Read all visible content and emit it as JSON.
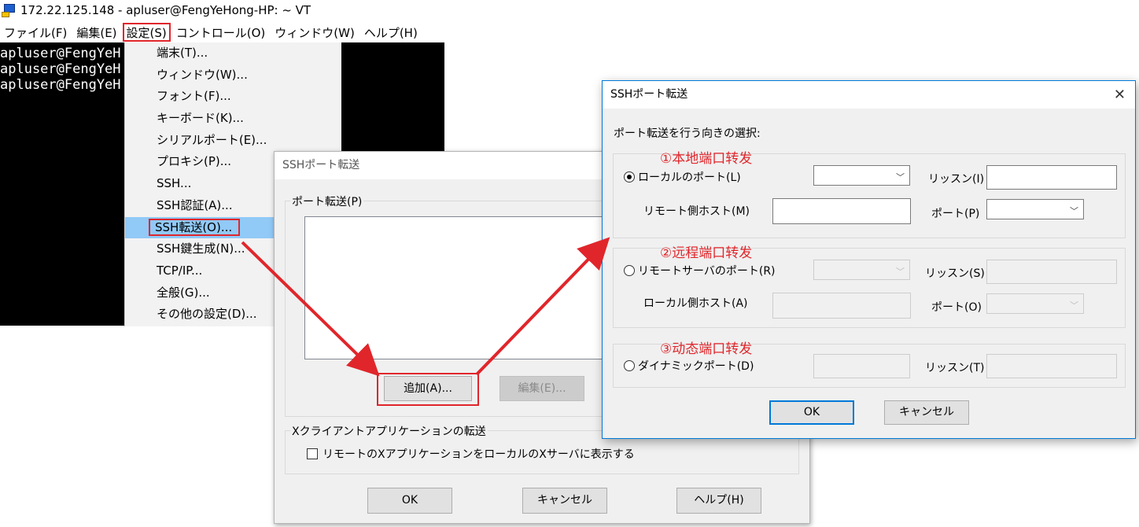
{
  "terminal": {
    "title": "172.22.125.148 - apluser@FengYeHong-HP: ~ VT",
    "menu": [
      "ファイル(F)",
      "編集(E)",
      "設定(S)",
      "コントロール(O)",
      "ウィンドウ(W)",
      "ヘルプ(H)"
    ],
    "lines": [
      "apluser@FengYeH",
      "apluser@FengYeH",
      "apluser@FengYeH"
    ]
  },
  "settings_menu": {
    "items": [
      "端末(T)...",
      "ウィンドウ(W)...",
      "フォント(F)...",
      "キーボード(K)...",
      "シリアルポート(E)...",
      "プロキシ(P)...",
      "SSH...",
      "SSH認証(A)...",
      "SSH転送(O)...",
      "SSH鍵生成(N)...",
      "TCP/IP...",
      "全般(G)...",
      "その他の設定(D)..."
    ]
  },
  "forward_dialog": {
    "title": "SSHポート転送",
    "group_label": "ポート転送(P)",
    "add_button": "追加(A)...",
    "edit_button": "編集(E)...",
    "x_group_label": "Xクライアントアプリケーションの転送",
    "x_checkbox_label": "リモートのXアプリケーションをローカルのXサーバに表示する",
    "ok_button": "OK",
    "cancel_button": "キャンセル",
    "help_button": "ヘルプ(H)"
  },
  "direction_dialog": {
    "title": "SSHポート転送",
    "close_glyph": "✕",
    "prompt": "ポート転送を行う向きの選択:",
    "annotation_local": "①本地端口转发",
    "annotation_remote": "②远程端口转发",
    "annotation_dynamic": "③动态端口转发",
    "local": {
      "radio_label": "ローカルのポート(L)",
      "listen_label": "リッスン(I)",
      "host_label": "リモート側ホスト(M)",
      "port_label": "ポート(P)"
    },
    "remote": {
      "radio_label": "リモートサーバのポート(R)",
      "listen_label": "リッスン(S)",
      "host_label": "ローカル側ホスト(A)",
      "port_label": "ポート(O)"
    },
    "dynamic": {
      "radio_label": "ダイナミックポート(D)",
      "listen_label": "リッスン(T)"
    },
    "ok_button": "OK",
    "cancel_button": "キャンセル"
  },
  "colors": {
    "highlight_red": "#e0262b",
    "menu_selection": "#91c9f7",
    "dialog_accent": "#0078d7"
  },
  "icons": {
    "terminal_app": "teraterm-icon",
    "chevron": "chevron-down-icon",
    "close": "close-icon"
  }
}
